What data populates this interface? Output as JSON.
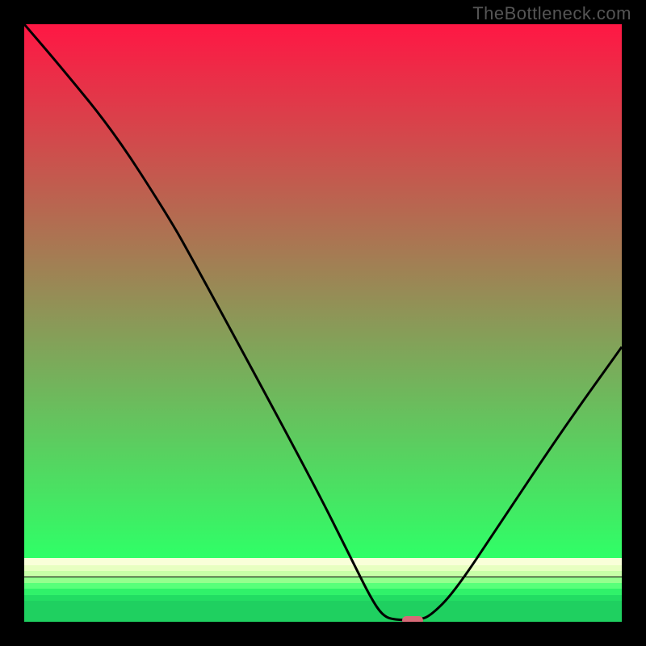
{
  "watermark": "TheBottleneck.com",
  "colors": {
    "black": "#000000",
    "curve": "#000000",
    "marker": "#d86a77"
  },
  "chart_data": {
    "type": "line",
    "title": "",
    "xlabel": "",
    "ylabel": "",
    "xlim": [
      0,
      100
    ],
    "ylim": [
      0,
      100
    ],
    "grid": false,
    "legend": false,
    "gradient_bands": [
      {
        "pos": 0.0,
        "height": 0.893,
        "from": "#ff1744",
        "to": "#2fff67"
      },
      {
        "pos": 0.893,
        "height": 0.012,
        "from": "#f9ffd9",
        "to": "#f9ffd9"
      },
      {
        "pos": 0.905,
        "height": 0.01,
        "from": "#e7ffc1",
        "to": "#e7ffc1"
      },
      {
        "pos": 0.915,
        "height": 0.01,
        "from": "#c8ffa8",
        "to": "#c8ffa8"
      },
      {
        "pos": 0.925,
        "height": 0.01,
        "from": "#95ff8e",
        "to": "#95ff8e"
      },
      {
        "pos": 0.935,
        "height": 0.01,
        "from": "#58ff7a",
        "to": "#58ff7a"
      },
      {
        "pos": 0.945,
        "height": 0.01,
        "from": "#30f26a",
        "to": "#30f26a"
      },
      {
        "pos": 0.955,
        "height": 0.01,
        "from": "#22dd63",
        "to": "#22dd63"
      },
      {
        "pos": 0.965,
        "height": 0.035,
        "from": "#1fd060",
        "to": "#1fd060"
      }
    ],
    "series": [
      {
        "name": "bottleneck-curve",
        "points": [
          {
            "x": 0,
            "y": 100
          },
          {
            "x": 6,
            "y": 93
          },
          {
            "x": 15,
            "y": 82
          },
          {
            "x": 24,
            "y": 68
          },
          {
            "x": 28,
            "y": 61
          },
          {
            "x": 48,
            "y": 24
          },
          {
            "x": 55,
            "y": 10
          },
          {
            "x": 58,
            "y": 4
          },
          {
            "x": 60,
            "y": 1
          },
          {
            "x": 62,
            "y": 0.3
          },
          {
            "x": 66,
            "y": 0.3
          },
          {
            "x": 68,
            "y": 1
          },
          {
            "x": 72,
            "y": 5
          },
          {
            "x": 80,
            "y": 17
          },
          {
            "x": 90,
            "y": 32
          },
          {
            "x": 100,
            "y": 46
          }
        ]
      }
    ],
    "marker": {
      "x": 65,
      "y": 0.3,
      "w": 3.4,
      "h": 1.4
    }
  }
}
